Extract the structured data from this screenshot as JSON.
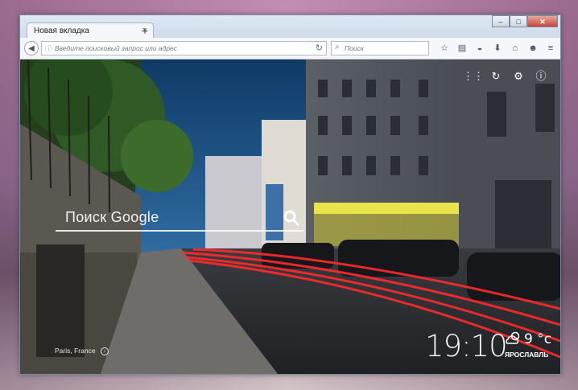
{
  "browser": {
    "tab": {
      "title": "Новая вкладка",
      "close": "×"
    },
    "new_tab": "+",
    "window_controls": {
      "minimize": "–",
      "maximize": "□",
      "close": "✕"
    },
    "url_placeholder": "Введите поисковый запрос или адрес",
    "search_placeholder": "Поиск"
  },
  "page": {
    "search_label": "Поиск Google",
    "time": "19:10",
    "weather": {
      "temp": "9 °c",
      "city": "ЯРОСЛАВЛЬ",
      "icon": "partly-cloudy-icon"
    },
    "photo_location": "Paris, France"
  },
  "colors": {
    "accent_red": "#ff2a2a",
    "night_sky": "#1f4f7c",
    "sign_yellow": "#e8e44a"
  }
}
